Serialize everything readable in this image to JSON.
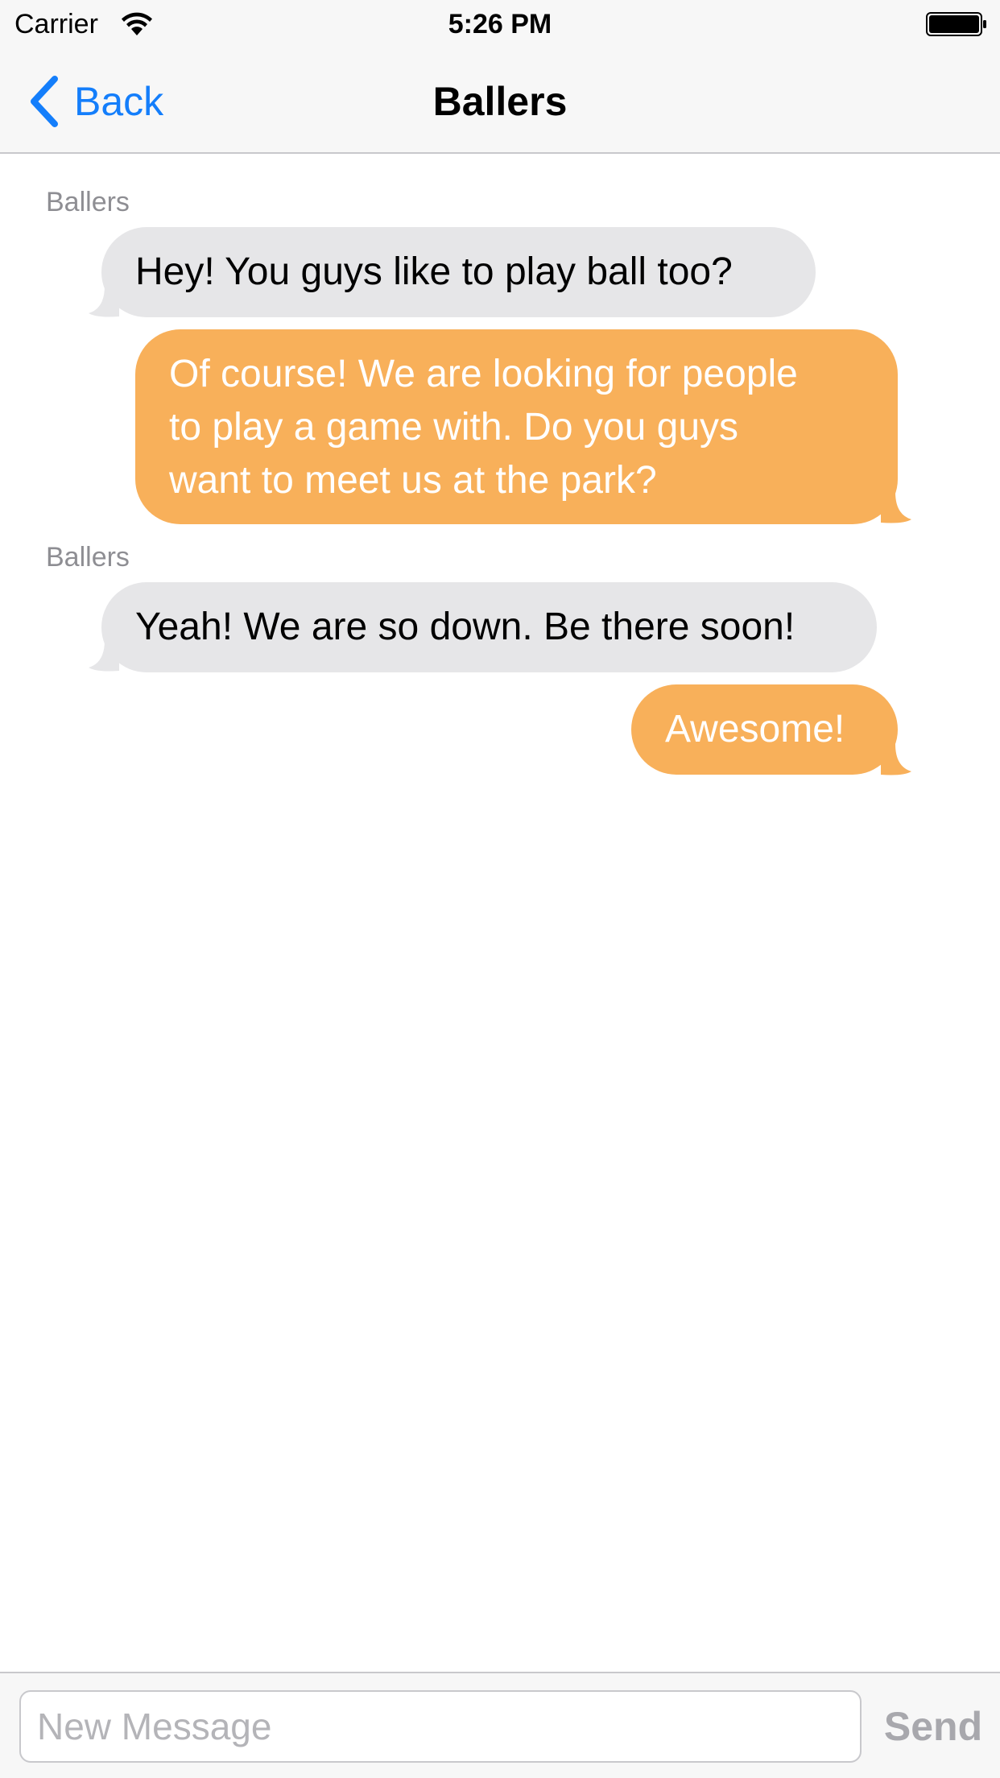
{
  "status_bar": {
    "carrier": "Carrier",
    "time": "5:26 PM"
  },
  "nav": {
    "back_label": "Back",
    "title": "Ballers"
  },
  "messages": [
    {
      "sender": "Ballers",
      "direction": "incoming",
      "text": "Hey! You guys like to play ball too?"
    },
    {
      "sender": "",
      "direction": "outgoing",
      "lines": [
        "Of course! We are looking for people",
        "to play a game with. Do you guys",
        "want to meet us at the park?"
      ]
    },
    {
      "sender": "Ballers",
      "direction": "incoming",
      "text": "Yeah! We are so down. Be there soon!"
    },
    {
      "sender": "",
      "direction": "outgoing",
      "text": "Awesome!"
    }
  ],
  "composer": {
    "placeholder": "New Message",
    "value": "",
    "send_label": "Send"
  },
  "colors": {
    "accent": "#147efb",
    "incoming_bubble": "#e6e6e8",
    "outgoing_bubble": "#f8b05a",
    "bar_background": "#f7f7f7"
  },
  "icons": {
    "wifi": "wifi-icon",
    "battery": "battery-icon",
    "back": "chevron-left-icon"
  }
}
